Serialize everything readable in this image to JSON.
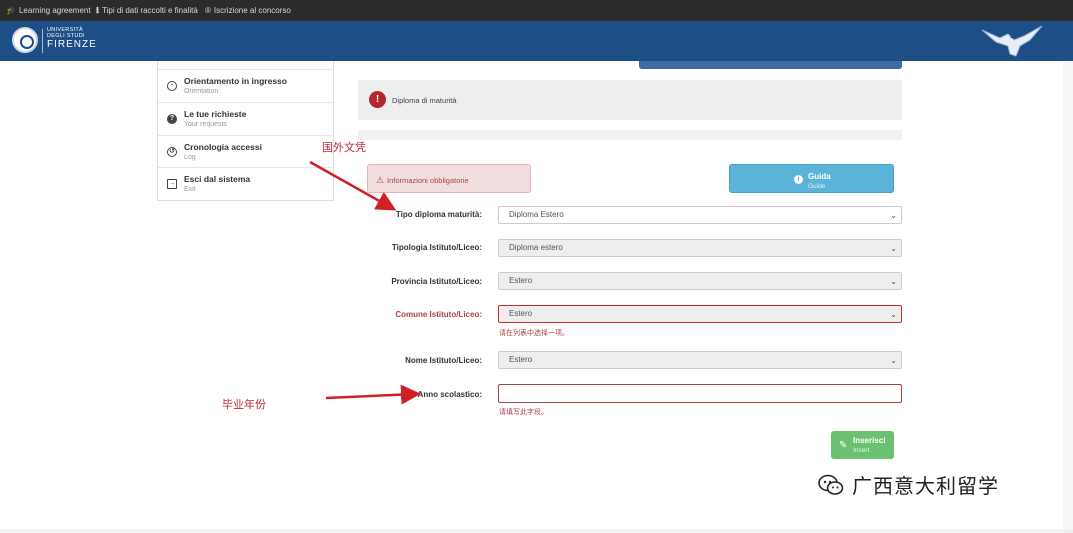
{
  "topbar": {
    "links": [
      {
        "label": "Learning agreement",
        "icon": "graduation-cap-icon"
      },
      {
        "label": "Tipi di dati raccolti e finalità",
        "icon": "info-icon"
      },
      {
        "label": "Iscrizione al concorso",
        "icon": "register-icon"
      }
    ]
  },
  "header": {
    "logo_small": "UNIVERSITÀ DEGLI STUDI",
    "logo_big": "FIRENZE",
    "bg_color": "#1d4f86"
  },
  "sidebar": {
    "items": [
      {
        "label": "Orientamento in ingresso",
        "sub": "Orientation",
        "icon": "compass-icon"
      },
      {
        "label": "Le tue richieste",
        "sub": "Your requests",
        "icon": "question-icon"
      },
      {
        "label": "Cronologia accessi",
        "sub": "Log",
        "icon": "history-icon"
      },
      {
        "label": "Esci dal sistema",
        "sub": "Exit",
        "icon": "exit-icon"
      }
    ]
  },
  "panel": {
    "title": "Diploma di maturità",
    "icon": "warning-icon"
  },
  "alert": {
    "text": "Informazioni obbligatorie"
  },
  "guide_button": {
    "label": "Guida",
    "sub": "Guide"
  },
  "form": {
    "fields": [
      {
        "label": "Tipo diploma maturità:",
        "value": "Diploma Estero"
      },
      {
        "label": "Tipologia Istituto/Liceo:",
        "value": "Diploma estero"
      },
      {
        "label": "Provincia Istituto/Liceo:",
        "value": "Estero"
      },
      {
        "label": "Comune Istituto/Liceo:",
        "value": "Estero",
        "error": "请在列表中选择一项。"
      },
      {
        "label": "Nome Istituto/Liceo:",
        "value": "Estero"
      },
      {
        "label": "Anno scolastico:",
        "value": "",
        "error": "请填写此字段。"
      }
    ]
  },
  "submit_button": {
    "label": "Inserisci",
    "sub": "Insert"
  },
  "annotations": {
    "foreign_doc": "国外文凭",
    "grad_year": "毕业年份",
    "color": "#c0272d"
  },
  "watermark": {
    "text": "广西意大利留学"
  }
}
